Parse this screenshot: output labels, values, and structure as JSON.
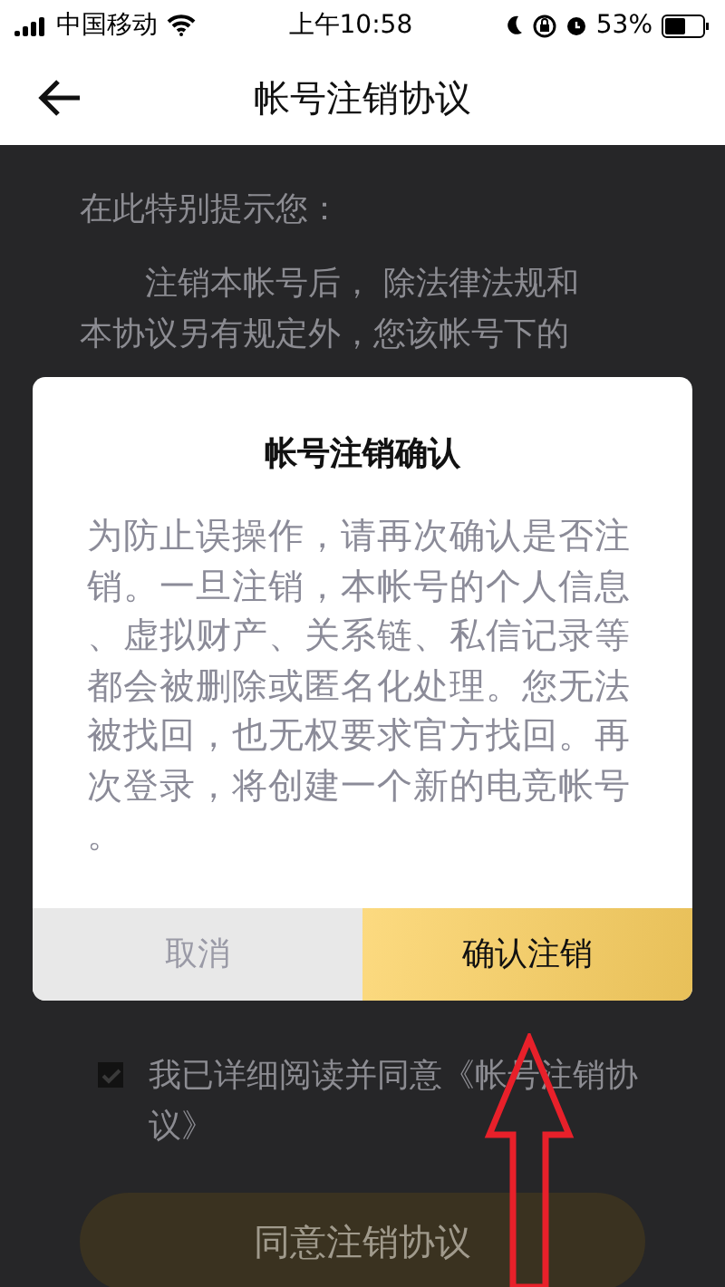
{
  "status_bar": {
    "carrier": "中国移动",
    "time": "上午10:58",
    "battery": "53%"
  },
  "nav": {
    "title": "帐号注销协议"
  },
  "background_text": [
    "在此特别提示您：",
    "注销本帐号后， 除法律法规和",
    "本协议另有规定外，您该帐号下的"
  ],
  "agreement": {
    "checked": true,
    "label": "我已详细阅读并同意《帐号注销协议》"
  },
  "agree_button": "同意注销协议",
  "dialog": {
    "title": "帐号注销确认",
    "message": "为防止误操作，请再次确认是否注销。一旦注销，本帐号的个人信息、虚拟财产、关系链、私信记录等都会被删除或匿名化处理。您无法被找回，也无权要求官方找回。再次登录，将创建一个新的电竞帐号。",
    "buttons": [
      {
        "kind": "cancel",
        "label": "取消"
      },
      {
        "kind": "confirm",
        "label": "确认注销"
      }
    ]
  }
}
